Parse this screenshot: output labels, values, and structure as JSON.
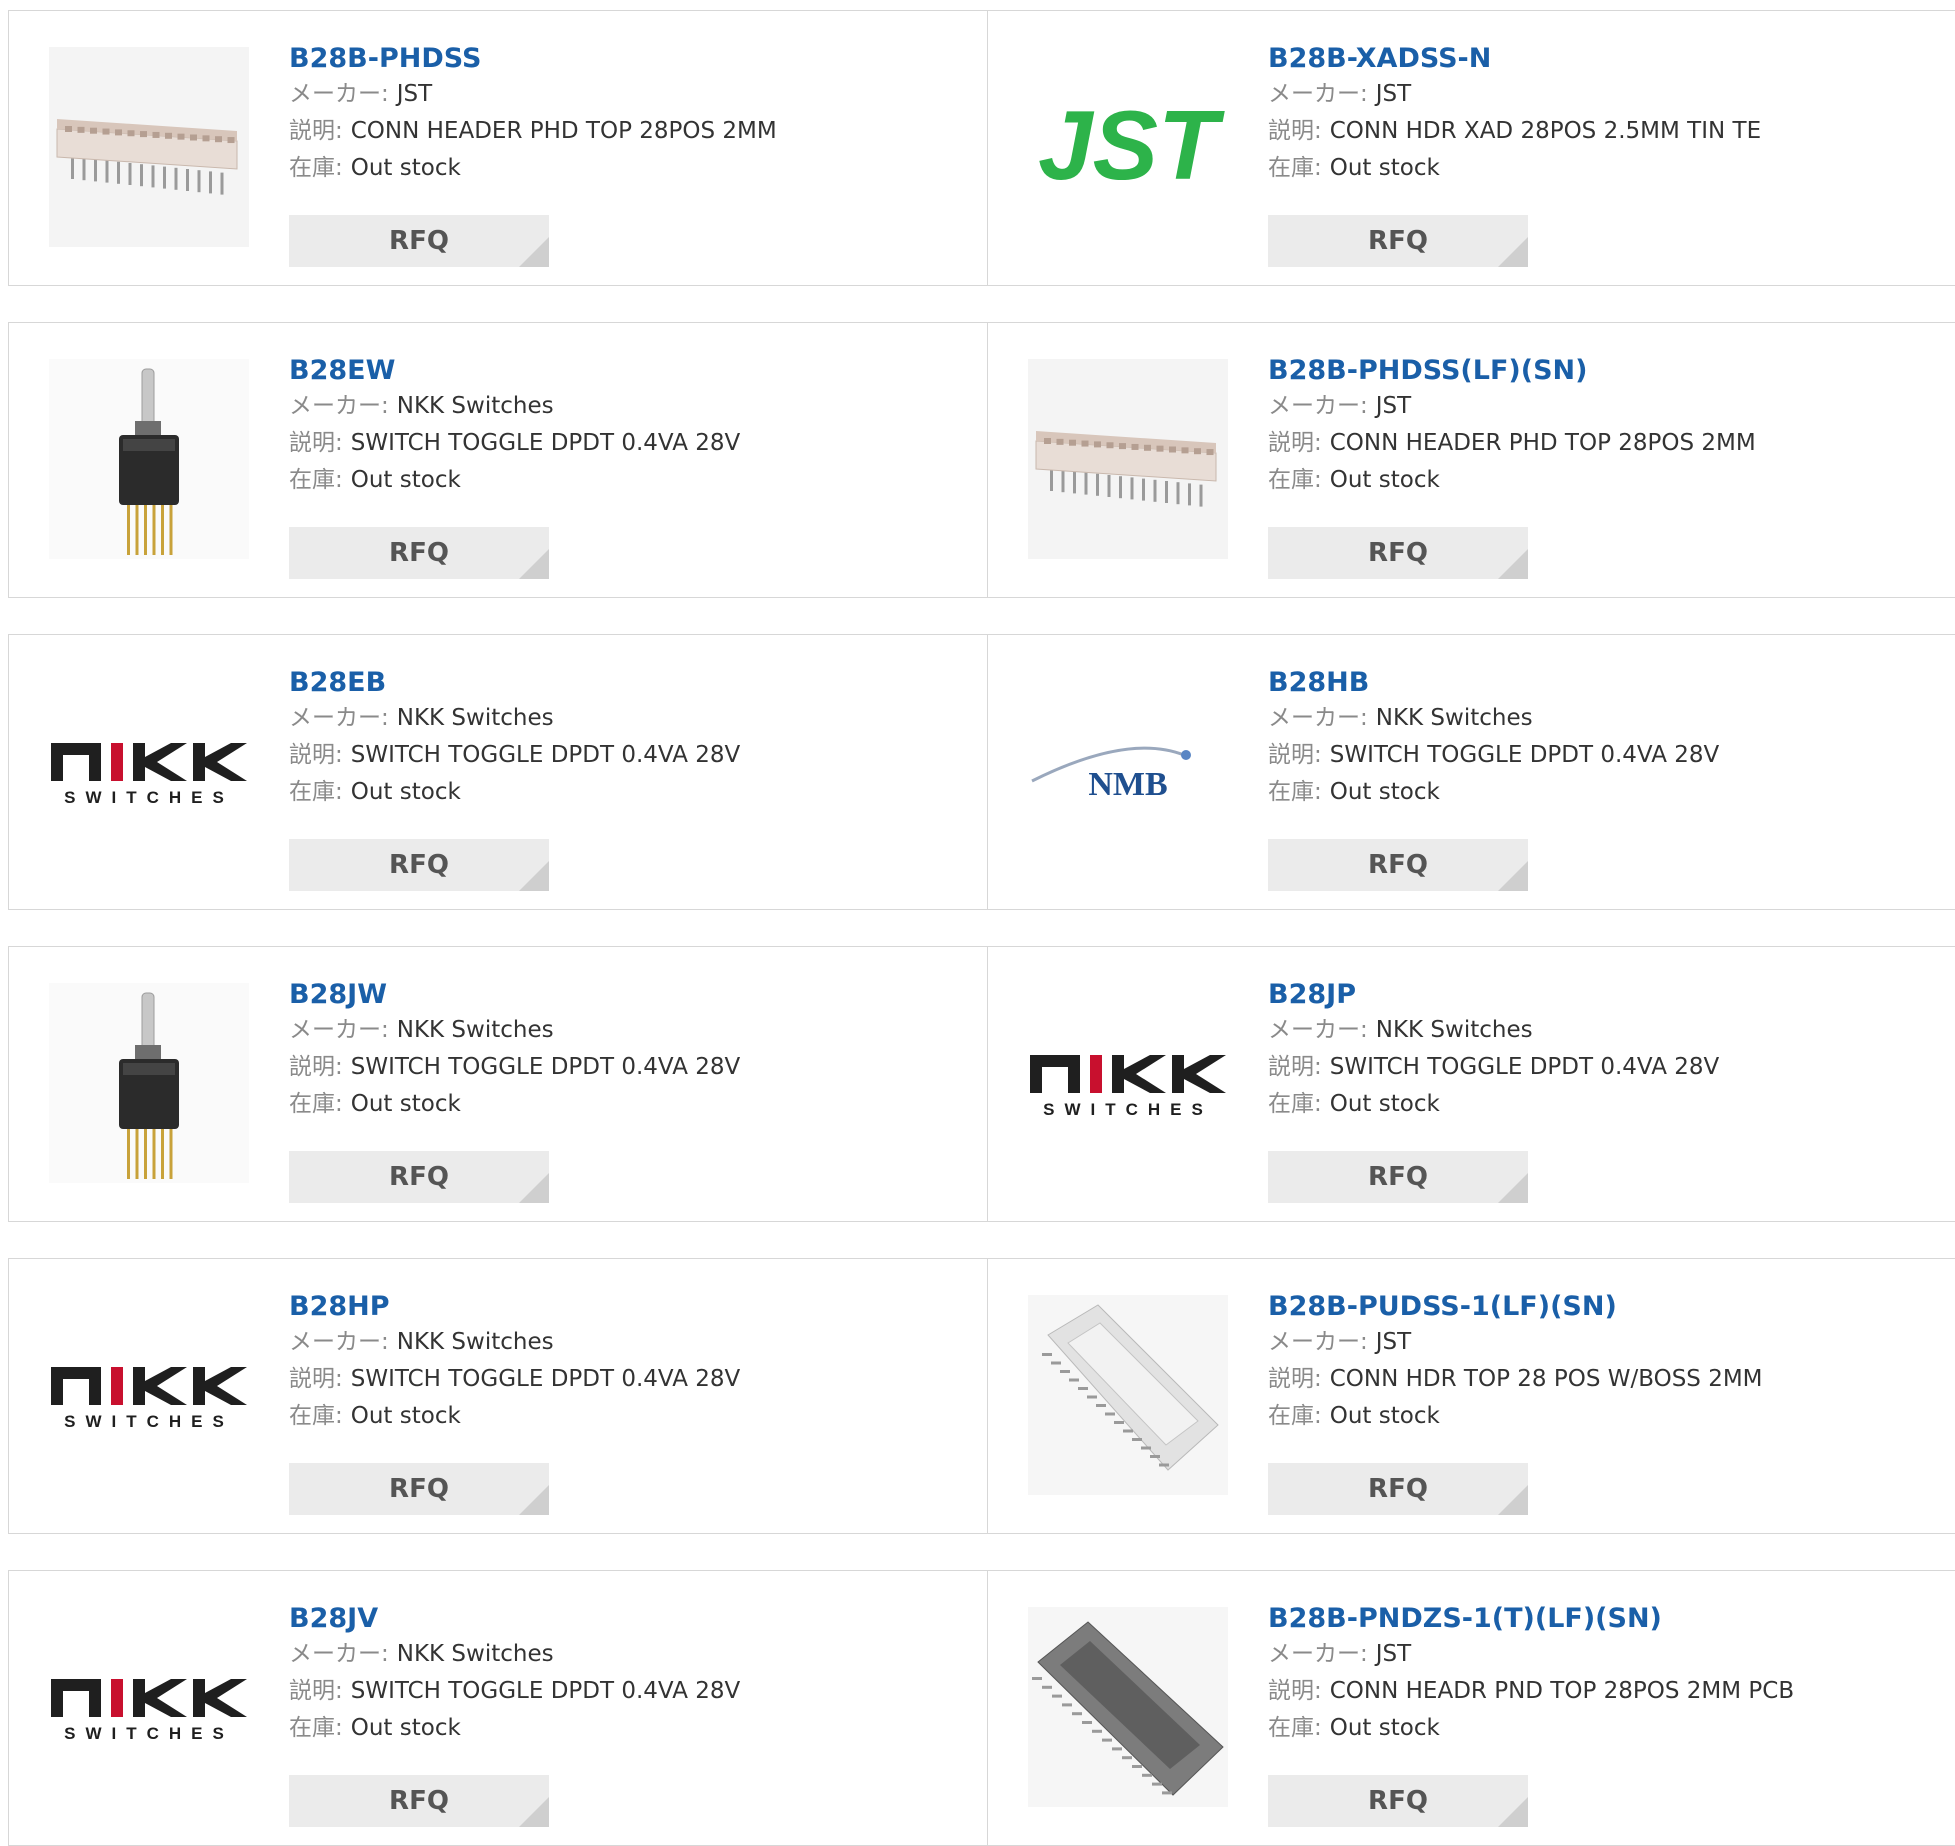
{
  "labels": {
    "maker": "メーカー",
    "desc": "説明",
    "stock": "在庫",
    "sep": ":"
  },
  "rfq_label": "RFQ",
  "colors": {
    "part_link": "#1a5fa8",
    "card_border": "#d7d7d7",
    "rfq_bg": "#ebebeb",
    "jst_green": "#2db34a",
    "nmb_blue": "#1f4f8f"
  },
  "products": [
    {
      "pn": "B28B-PHDSS",
      "maker": "JST",
      "desc": "CONN HEADER PHD TOP 28POS 2MM",
      "stock": "Out stock",
      "image": "connector-header-image"
    },
    {
      "pn": "B28B-XADSS-N",
      "maker": "JST",
      "desc": "CONN HDR XAD 28POS 2.5MM TIN TE",
      "stock": "Out stock",
      "image": "jst-logo",
      "logo_text": "JST"
    },
    {
      "pn": "B28EW",
      "maker": "NKK Switches",
      "desc": "SWITCH TOGGLE DPDT 0.4VA 28V",
      "stock": "Out stock",
      "image": "toggle-switch-image"
    },
    {
      "pn": "B28B-PHDSS(LF)(SN)",
      "maker": "JST",
      "desc": "CONN HEADER PHD TOP 28POS 2MM",
      "stock": "Out stock",
      "image": "connector-header-image"
    },
    {
      "pn": "B28EB",
      "maker": "NKK Switches",
      "desc": "SWITCH TOGGLE DPDT 0.4VA 28V",
      "stock": "Out stock",
      "image": "nkk-switches-logo",
      "logo_text": "SWITCHES"
    },
    {
      "pn": "B28HB",
      "maker": "NKK Switches",
      "desc": "SWITCH TOGGLE DPDT 0.4VA 28V",
      "stock": "Out stock",
      "image": "nmb-logo",
      "logo_text": "NMB"
    },
    {
      "pn": "B28JW",
      "maker": "NKK Switches",
      "desc": "SWITCH TOGGLE DPDT 0.4VA 28V",
      "stock": "Out stock",
      "image": "toggle-switch-image"
    },
    {
      "pn": "B28JP",
      "maker": "NKK Switches",
      "desc": "SWITCH TOGGLE DPDT 0.4VA 28V",
      "stock": "Out stock",
      "image": "nkk-switches-logo",
      "logo_text": "SWITCHES"
    },
    {
      "pn": "B28HP",
      "maker": "NKK Switches",
      "desc": "SWITCH TOGGLE DPDT 0.4VA 28V",
      "stock": "Out stock",
      "image": "nkk-switches-logo",
      "logo_text": "SWITCHES"
    },
    {
      "pn": "B28B-PUDSS-1(LF)(SN)",
      "maker": "JST",
      "desc": "CONN HDR TOP 28 POS W/BOSS 2MM",
      "stock": "Out stock",
      "image": "boxed-header-image"
    },
    {
      "pn": "B28JV",
      "maker": "NKK Switches",
      "desc": "SWITCH TOGGLE DPDT 0.4VA 28V",
      "stock": "Out stock",
      "image": "nkk-switches-logo",
      "logo_text": "SWITCHES"
    },
    {
      "pn": "B28B-PNDZS-1(T)(LF)(SN)",
      "maker": "JST",
      "desc": "CONN HEADR PND TOP 28POS 2MM PCB",
      "stock": "Out stock",
      "image": "dark-header-image"
    }
  ]
}
